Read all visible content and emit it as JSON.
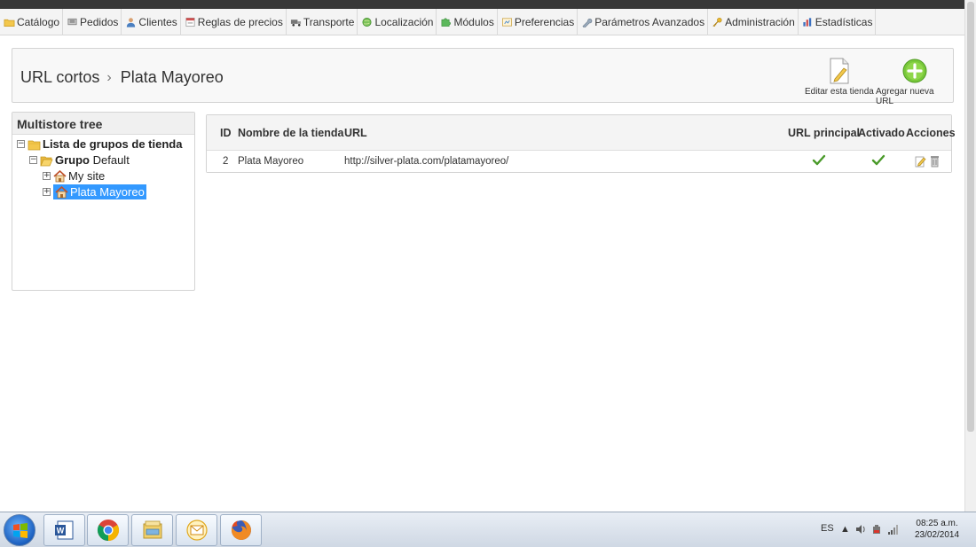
{
  "menu": [
    {
      "label": "Catálogo",
      "icon": "folder-icon",
      "color": "#f0c040"
    },
    {
      "label": "Pedidos",
      "icon": "cart-icon",
      "color": "#888888"
    },
    {
      "label": "Clientes",
      "icon": "user-icon",
      "color": "#4a7fc0"
    },
    {
      "label": "Reglas de precios",
      "icon": "price-rules-icon",
      "color": "#d05050"
    },
    {
      "label": "Transporte",
      "icon": "truck-icon",
      "color": "#6a6a6a"
    },
    {
      "label": "Localización",
      "icon": "globe-icon",
      "color": "#4caf50"
    },
    {
      "label": "Módulos",
      "icon": "puzzle-icon",
      "color": "#5cb85c"
    },
    {
      "label": "Preferencias",
      "icon": "preferences-icon",
      "color": "#d9a84a"
    },
    {
      "label": "Parámetros Avanzados",
      "icon": "wrench-icon",
      "color": "#7a8fa6"
    },
    {
      "label": "Administración",
      "icon": "key-icon",
      "color": "#e0b030"
    },
    {
      "label": "Estadísticas",
      "icon": "bar-chart-icon",
      "color": "#3a70c0"
    }
  ],
  "header": {
    "breadcrumb_parent": "URL cortos",
    "breadcrumb_separator": "›",
    "breadcrumb_current": "Plata Mayoreo",
    "edit_store_label": "Editar esta tienda",
    "add_url_label": "Agregar nueva URL"
  },
  "tree": {
    "title": "Multistore tree",
    "root_label": "Lista de grupos de tienda",
    "group_label_bold": "Grupo",
    "group_label_rest": " Default",
    "shops": [
      "My site",
      "Plata Mayoreo"
    ],
    "selected_shop": "Plata Mayoreo"
  },
  "table": {
    "headers": [
      "ID",
      "Nombre de la tienda",
      "URL",
      "URL principal",
      "Activado",
      "Acciones"
    ],
    "rows": [
      {
        "id": "2",
        "name": "Plata Mayoreo",
        "url": "http://silver-plata.com/platamayoreo/",
        "main": true,
        "active": true
      }
    ],
    "check_color": "#4a9a2a"
  },
  "taskbar": {
    "language": "ES",
    "time": "08:25 a.m.",
    "date": "23/02/2014",
    "apps": [
      "word-icon",
      "chrome-icon",
      "file-explorer-icon",
      "outlook-icon",
      "firefox-icon"
    ]
  }
}
